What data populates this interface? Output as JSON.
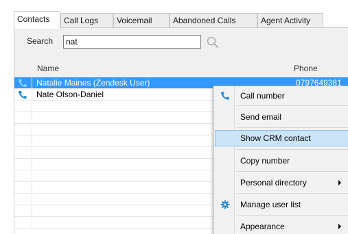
{
  "tabs": [
    {
      "label": "Contacts",
      "active": true
    },
    {
      "label": "Call Logs",
      "active": false
    },
    {
      "label": "Voicemail",
      "active": false
    },
    {
      "label": "Abandoned Calls",
      "active": false
    },
    {
      "label": "Agent Activity",
      "active": false
    }
  ],
  "search": {
    "label": "Search",
    "value": "nat"
  },
  "grid": {
    "columns": {
      "name": "Name",
      "phone": "Phone"
    },
    "rows": [
      {
        "name": "Natalie Maines (Zendesk User)",
        "phone": "0797649381",
        "icon": "phone-icon",
        "selected": true
      },
      {
        "name": "Nate Olson-Daniel",
        "phone": "",
        "icon": "phone-icon",
        "selected": false
      }
    ],
    "selection_color": "#3399ff",
    "phone_icon_color": "#1e88d4"
  },
  "context_menu": {
    "items": [
      {
        "label": "Call number",
        "icon": "phone-icon",
        "submenu": false,
        "highlighted": false
      },
      {
        "label": "Send email",
        "icon": "",
        "submenu": false,
        "highlighted": false
      },
      {
        "label": "Show CRM contact",
        "icon": "",
        "submenu": false,
        "highlighted": true
      },
      {
        "label": "Copy number",
        "icon": "",
        "submenu": false,
        "highlighted": false
      },
      {
        "label": "Personal directory",
        "icon": "",
        "submenu": true,
        "highlighted": false
      },
      {
        "label": "Manage user list",
        "icon": "gear-icon",
        "submenu": false,
        "highlighted": false
      },
      {
        "label": "Appearance",
        "icon": "",
        "submenu": true,
        "highlighted": false
      }
    ],
    "highlight_color": "#cce4f7"
  }
}
